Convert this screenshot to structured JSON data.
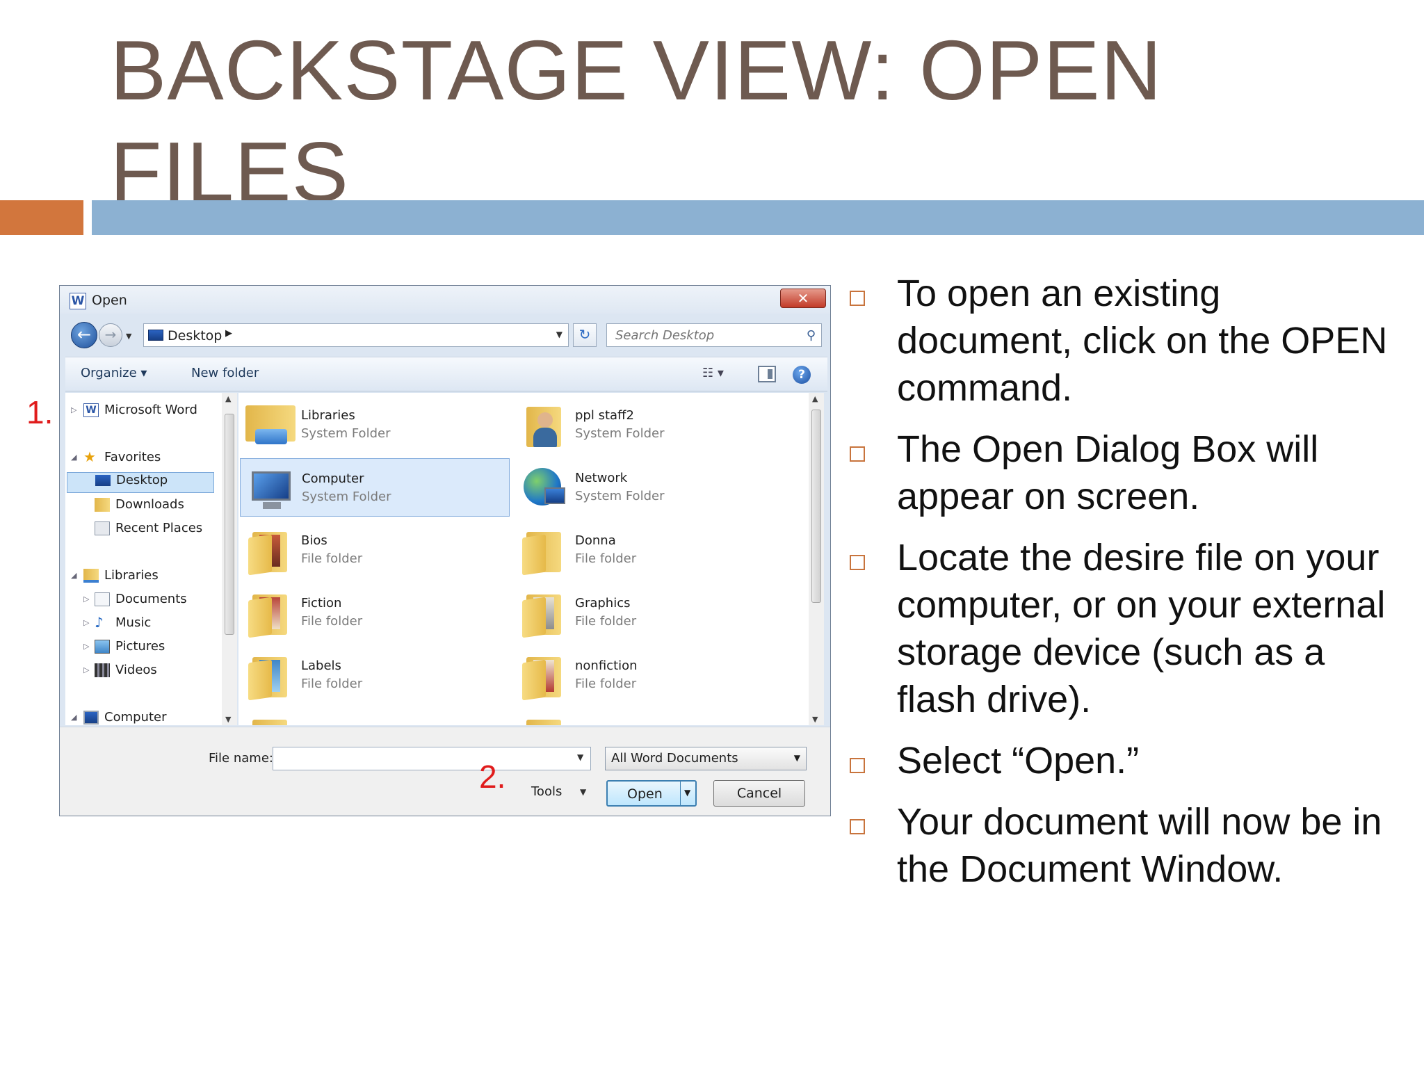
{
  "slide": {
    "title": "BACKSTAGE VIEW: OPEN FILES",
    "step_1": "1.",
    "step_2": "2.",
    "bullets": [
      "To open an existing document, click on the OPEN command.",
      "The Open Dialog Box will appear on screen.",
      "Locate the desire file on your computer, or on your external storage device (such as a flash drive).",
      "Select “Open.”",
      "Your document will now be in the Document Window."
    ],
    "colors": {
      "title": "#6e5a50",
      "accent_orange": "#d2763d",
      "accent_blue": "#8cb1d2",
      "step_number": "#e01c1c"
    }
  },
  "dialog": {
    "title": "Open",
    "app_icon": "word-icon",
    "address": {
      "location": "Desktop"
    },
    "search": {
      "placeholder": "Search Desktop"
    },
    "toolbar": {
      "organize": "Organize",
      "new_folder": "New folder"
    },
    "navigation": {
      "microsoft_word": "Microsoft Word",
      "favorites": "Favorites",
      "desktop": "Desktop",
      "downloads": "Downloads",
      "recent_places": "Recent Places",
      "libraries": "Libraries",
      "documents": "Documents",
      "music": "Music",
      "pictures": "Pictures",
      "videos": "Videos",
      "computer": "Computer",
      "selected": "Desktop"
    },
    "files": [
      {
        "name": "Libraries",
        "type": "System Folder"
      },
      {
        "name": "ppl staff2",
        "type": "System Folder"
      },
      {
        "name": "Computer",
        "type": "System Folder"
      },
      {
        "name": "Network",
        "type": "System Folder"
      },
      {
        "name": "Bios",
        "type": "File folder"
      },
      {
        "name": "Donna",
        "type": "File folder"
      },
      {
        "name": "Fiction",
        "type": "File folder"
      },
      {
        "name": "Graphics",
        "type": "File folder"
      },
      {
        "name": "Labels",
        "type": "File folder"
      },
      {
        "name": "nonfiction",
        "type": "File folder"
      }
    ],
    "selected_file": "Computer",
    "file_name": {
      "label": "File name:",
      "value": ""
    },
    "filter": "All Word Documents",
    "tools": "Tools",
    "open_button": "Open",
    "cancel_button": "Cancel"
  }
}
